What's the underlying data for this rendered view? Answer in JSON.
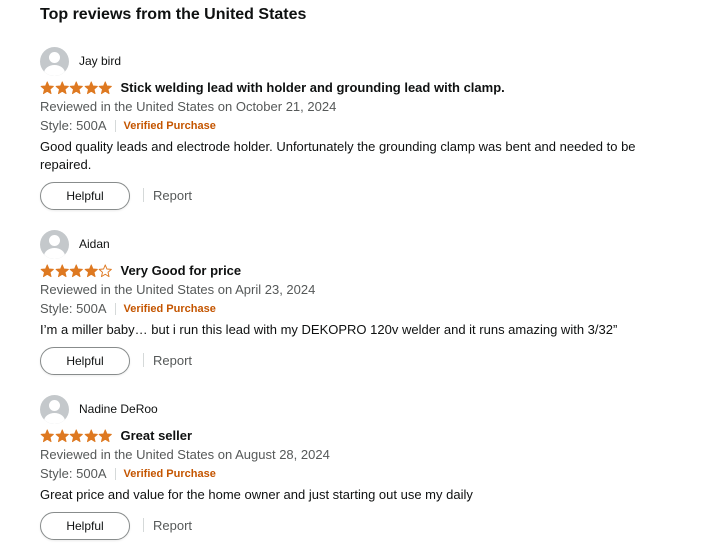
{
  "section": {
    "title": "Top reviews from the United States"
  },
  "colors": {
    "star_fill": "#de7921",
    "verified": "#c45500",
    "meta": "#565959"
  },
  "reviews": [
    {
      "author": "Jay bird",
      "rating": 5,
      "title": "Stick welding lead with holder and grounding lead with clamp.",
      "date": "Reviewed in the United States on October 21, 2024",
      "style": "Style: 500A",
      "verified": "Verified Purchase",
      "body": "Good quality leads and electrode holder. Unfortunately the grounding clamp was bent and needed to be repaired.",
      "helpful_label": "Helpful",
      "report_label": "Report"
    },
    {
      "author": "Aidan",
      "rating": 4,
      "title": "Very Good for price",
      "date": "Reviewed in the United States on April 23, 2024",
      "style": "Style: 500A",
      "verified": "Verified Purchase",
      "body": "I’m a miller baby… but i run this lead with my DEKOPRO 120v welder and it runs amazing with 3/32”",
      "helpful_label": "Helpful",
      "report_label": "Report"
    },
    {
      "author": "Nadine DeRoo",
      "rating": 5,
      "title": "Great seller",
      "date": "Reviewed in the United States on August 28, 2024",
      "style": "Style: 500A",
      "verified": "Verified Purchase",
      "body": "Great price and value for the home owner and just starting out use my daily",
      "helpful_label": "Helpful",
      "report_label": "Report"
    }
  ]
}
